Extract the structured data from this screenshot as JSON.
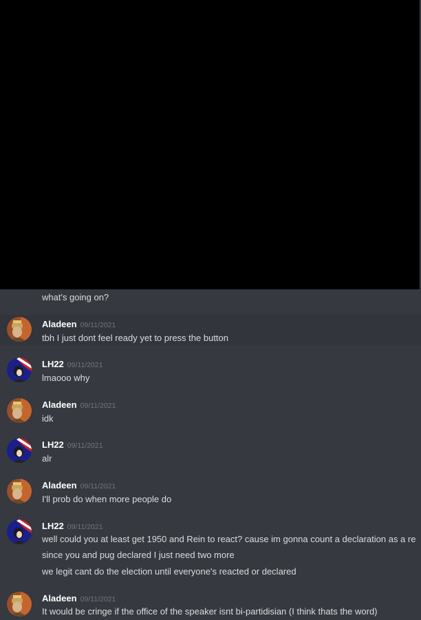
{
  "channel": {
    "continuation_text": "what's going on?"
  },
  "messages": [
    {
      "username": "Aladeen",
      "timestamp": "09/11/2021",
      "avatar_icon": "king-portrait-avatar",
      "lines": [
        "tbh I just dont feel ready yet to press the button"
      ]
    },
    {
      "username": "LH22",
      "timestamp": "09/11/2021",
      "avatar_icon": "flag-portrait-avatar",
      "lines": [
        "lmaooo why"
      ]
    },
    {
      "username": "Aladeen",
      "timestamp": "09/11/2021",
      "avatar_icon": "king-portrait-avatar",
      "lines": [
        "idk"
      ]
    },
    {
      "username": "LH22",
      "timestamp": "09/11/2021",
      "avatar_icon": "flag-portrait-avatar",
      "lines": [
        "alr"
      ]
    },
    {
      "username": "Aladeen",
      "timestamp": "09/11/2021",
      "avatar_icon": "king-portrait-avatar",
      "lines": [
        "I'll prob do when more people do"
      ]
    },
    {
      "username": "LH22",
      "timestamp": "09/11/2021",
      "avatar_icon": "flag-portrait-avatar",
      "lines": [
        "well could you at least get 1950 and Rein to react? cause im gonna count a declaration as a re",
        "since you and pug declared I just need two more",
        "we legit cant do the election until everyone's reacted or declared"
      ]
    },
    {
      "username": "Aladeen",
      "timestamp": "09/11/2021",
      "avatar_icon": "king-portrait-avatar",
      "lines": [
        "It would be cringe if the office of the speaker isnt bi-partidisian (I think thats the word)"
      ]
    }
  ],
  "colors": {
    "background": "#36393f",
    "hover_background": "#32353b",
    "username": "#ffffff",
    "message_text": "#dcddde",
    "timestamp": "#72767d",
    "top_region": "#000000"
  }
}
